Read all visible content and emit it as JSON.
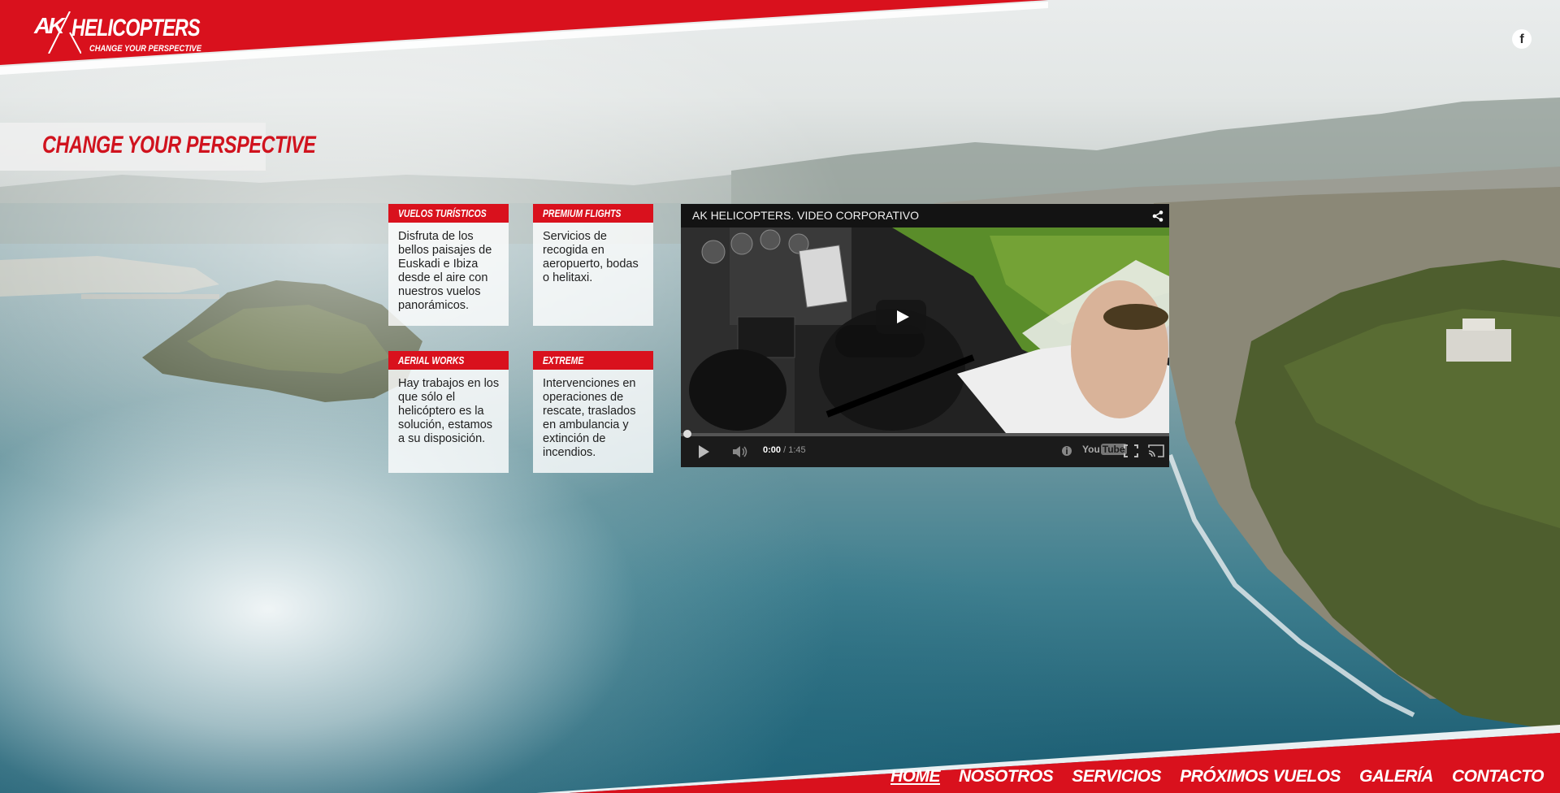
{
  "brand": {
    "logo_ak": "AK",
    "logo_title": "HELICOPTERS",
    "logo_tagline": "CHANGE YOUR PERSPECTIVE",
    "accent_color": "#d9111d"
  },
  "social": {
    "facebook_label": "f"
  },
  "hero": {
    "title": "CHANGE YOUR PERSPECTIVE"
  },
  "services": [
    {
      "title": "VUELOS TURÍSTICOS",
      "text": "Disfruta de los bellos paisajes de Euskadi e Ibiza desde el aire con nuestros vuelos panorámicos."
    },
    {
      "title": "PREMIUM FLIGHTS",
      "text": "Servicios de recogida en aeropuerto, bodas o helitaxi."
    },
    {
      "title": "AERIAL WORKS",
      "text": "Hay trabajos en los que sólo el helicóptero es la solución, estamos a su disposición."
    },
    {
      "title": "EXTREME",
      "text": "Intervenciones en operaciones de rescate, traslados en ambulancia y extinción de incendios."
    }
  ],
  "video": {
    "title": "AK HELICOPTERS. VIDEO CORPORATIVO",
    "current_time": "0:00",
    "duration": "/ 1:45",
    "youtube_label": "You",
    "youtube_label2": "Tube",
    "progress": 0
  },
  "nav": {
    "items": [
      {
        "label": "HOME",
        "active": true
      },
      {
        "label": "NOSOTROS"
      },
      {
        "label": "SERVICIOS"
      },
      {
        "label": "PRÓXIMOS VUELOS"
      },
      {
        "label": "GALERÍA"
      },
      {
        "label": "CONTACTO"
      }
    ]
  }
}
